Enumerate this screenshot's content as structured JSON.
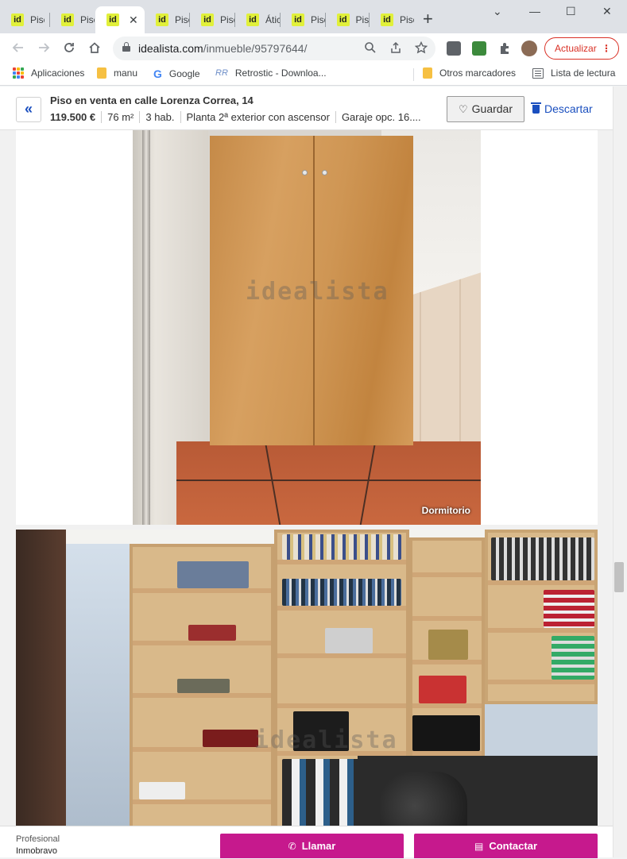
{
  "browser": {
    "tabs": [
      {
        "label": "Piso"
      },
      {
        "label": "Piso"
      },
      {
        "label": ""
      },
      {
        "label": "Piso"
      },
      {
        "label": "Piso"
      },
      {
        "label": "Ático"
      },
      {
        "label": "Piso"
      },
      {
        "label": "Piso"
      },
      {
        "label": "Piso"
      }
    ],
    "tab_favicon_text": "id",
    "new_tab": "+",
    "window_controls": {
      "minimize": "⌄",
      "min": "—",
      "max": "☐",
      "close": "✕"
    },
    "url_host": "idealista.com",
    "url_path": "/inmueble/95797644/",
    "update_button": "Actualizar",
    "bookmarks": [
      {
        "label": "Aplicaciones",
        "icon": "apps-grid-icon"
      },
      {
        "label": "manu",
        "icon": "folder-icon"
      },
      {
        "label": "Google",
        "icon": "google-icon"
      },
      {
        "label": "Retrostic - Downloa...",
        "icon": "retrostic-icon"
      },
      {
        "label": "Otros marcadores",
        "icon": "folder-icon"
      },
      {
        "label": "Lista de lectura",
        "icon": "reading-list-icon"
      }
    ]
  },
  "listing": {
    "title": "Piso en venta en calle Lorenza Correa, 14",
    "price": "119.500 €",
    "area": "76 m²",
    "rooms": "3 hab.",
    "floor": "Planta 2ª exterior con ascensor",
    "garage": "Garaje opc. 16....",
    "save_label": "Guardar",
    "discard_label": "Descartar"
  },
  "photos": [
    {
      "label": "Dormitorio",
      "watermark": "idealista"
    },
    {
      "label": "",
      "watermark": "idealista"
    }
  ],
  "contact_bar": {
    "type_label": "Profesional",
    "agency": "Inmobravo",
    "call_label": "Llamar",
    "contact_label": "Contactar"
  },
  "colors": {
    "brand_magenta": "#c6198d",
    "link_blue": "#1a4fbf",
    "update_red": "#d93025",
    "favicon_yellow": "#e1f03a"
  }
}
